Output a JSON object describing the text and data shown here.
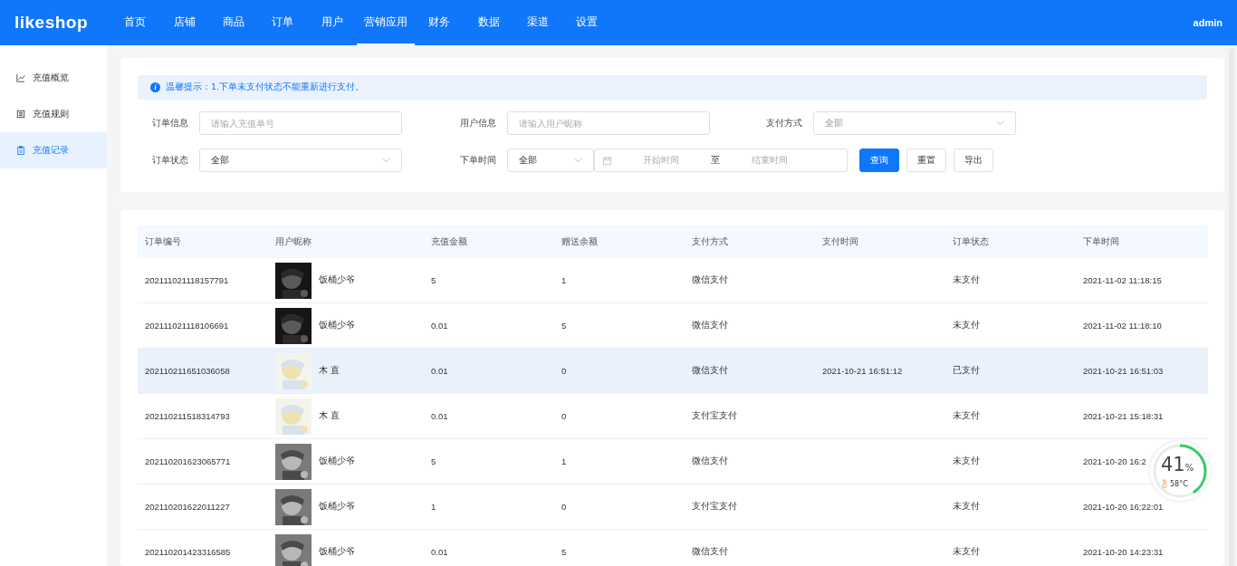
{
  "header": {
    "logo": "likeshop",
    "nav": [
      {
        "label": "首页",
        "selected": false
      },
      {
        "label": "店铺",
        "selected": false
      },
      {
        "label": "商品",
        "selected": false
      },
      {
        "label": "订单",
        "selected": false
      },
      {
        "label": "用户",
        "selected": false
      },
      {
        "label": "营销应用",
        "selected": true
      },
      {
        "label": "财务",
        "selected": false
      },
      {
        "label": "数据",
        "selected": false
      },
      {
        "label": "渠道",
        "selected": false
      },
      {
        "label": "设置",
        "selected": false
      }
    ],
    "user": "admin"
  },
  "sidebar": {
    "items": [
      {
        "label": "充值概览",
        "kind": "chart",
        "selected": false
      },
      {
        "label": "充值规则",
        "kind": "list",
        "selected": false
      },
      {
        "label": "充值记录",
        "kind": "clipboard",
        "selected": true
      }
    ]
  },
  "notice": {
    "icon": "i",
    "text": "温馨提示：1.下单未支付状态不能重新进行支付。"
  },
  "filters": {
    "order_info": {
      "label": "订单信息",
      "placeholder": "请输入充值单号"
    },
    "user_info": {
      "label": "用户信息",
      "placeholder": "请输入用户昵称"
    },
    "pay_method": {
      "label": "支付方式",
      "placeholder": "全部"
    },
    "order_status": {
      "label": "订单状态",
      "value": "全部"
    },
    "order_time": {
      "label": "下单时间",
      "value": "全部",
      "start_placeholder": "开始时间",
      "separator": "至",
      "end_placeholder": "结束时间"
    },
    "buttons": [
      {
        "label": "查询",
        "kind": "primary"
      },
      {
        "label": "重置",
        "kind": "default"
      },
      {
        "label": "导出",
        "kind": "default"
      }
    ]
  },
  "table": {
    "columns": [
      "订单编号",
      "用户昵称",
      "充值金额",
      "赠送余额",
      "支付方式",
      "支付时间",
      "订单状态",
      "下单时间"
    ],
    "rows": [
      {
        "order_no": "202111021118157791",
        "nickname": "饭桶少爷",
        "amount": "5",
        "bonus": "1",
        "pay_method": "微信支付",
        "pay_time": "",
        "status": "未支付",
        "order_time": "2021-11-02 11:18:15",
        "hovered": false
      },
      {
        "order_no": "202111021118106691",
        "nickname": "饭桶少爷",
        "amount": "0.01",
        "bonus": "5",
        "pay_method": "微信支付",
        "pay_time": "",
        "status": "未支付",
        "order_time": "2021-11-02 11:18:10",
        "hovered": false
      },
      {
        "order_no": "202110211651036058",
        "nickname": "木 直",
        "amount": "0.01",
        "bonus": "0",
        "pay_method": "微信支付",
        "pay_time": "2021-10-21 16:51:12",
        "status": "已支付",
        "order_time": "2021-10-21 16:51:03",
        "hovered": true
      },
      {
        "order_no": "202110211518314793",
        "nickname": "木 直",
        "amount": "0.01",
        "bonus": "0",
        "pay_method": "支付宝支付",
        "pay_time": "",
        "status": "未支付",
        "order_time": "2021-10-21 15:18:31",
        "hovered": false
      },
      {
        "order_no": "202110201623065771",
        "nickname": "饭桶少爷",
        "amount": "5",
        "bonus": "1",
        "pay_method": "微信支付",
        "pay_time": "",
        "status": "未支付",
        "order_time": "2021-10-20 16:2",
        "hovered": false
      },
      {
        "order_no": "202110201622011227",
        "nickname": "饭桶少爷",
        "amount": "1",
        "bonus": "0",
        "pay_method": "支付宝支付",
        "pay_time": "",
        "status": "未支付",
        "order_time": "2021-10-20 16:22:01",
        "hovered": false
      },
      {
        "order_no": "202110201423316585",
        "nickname": "饭桶少爷",
        "amount": "0.01",
        "bonus": "5",
        "pay_method": "微信支付",
        "pay_time": "",
        "status": "未支付",
        "order_time": "2021-10-20 14:23:31",
        "hovered": false
      }
    ]
  },
  "monitor_widget": {
    "level": 0.41,
    "value": "41",
    "unit": "%",
    "temperature": "58°C"
  }
}
